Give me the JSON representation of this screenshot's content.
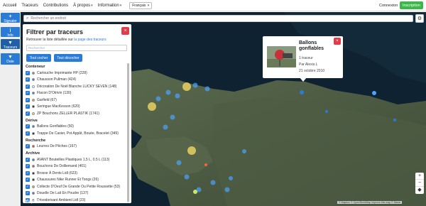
{
  "nav": {
    "items": [
      "Accueil",
      "Traceurs",
      "Contributions",
      "À propos",
      "Information"
    ],
    "language": "Français",
    "login": "Connexion",
    "signup": "Inscription"
  },
  "toolbar": {
    "signal": "Signaler",
    "info": "Info",
    "tracers": "Traceurs",
    "date": "Date"
  },
  "search": {
    "placeholder": "Rechercher un endroit"
  },
  "filter": {
    "title": "Filtrer par traceurs",
    "desc_prefix": "Retrouver la liste détaillée sur",
    "desc_link": "la page des traceurs",
    "filter_placeholder": "Rechercher",
    "check_all": "Tout cocher",
    "uncheck_all": "Tout décocher",
    "groups": [
      {
        "name": "Conteneur",
        "items": [
          {
            "label": "Cartouche Imprimante HP (228)",
            "color": "#888888"
          },
          {
            "label": "Chausson Pullman (424)",
            "color": "#2a7bd6"
          },
          {
            "label": "Décoration De Noël Blanche LUCKY SEVEN (148)",
            "color": "#ffffff"
          },
          {
            "label": "Flacon D'Otrivin (130)",
            "color": "#2a7bd6"
          },
          {
            "label": "Garfield (67)",
            "color": "#f0a030"
          },
          {
            "label": "Seringue MacKesson (620)",
            "color": "#222222"
          },
          {
            "label": "ZP Bouchons ZELLER PLASTIK (1741)",
            "color": "#e8e060"
          }
        ]
      },
      {
        "name": "Dérive",
        "items": [
          {
            "label": "Ballons Gonflables (50)",
            "color": "#2a7bd6"
          },
          {
            "label": "Trappe De Casier, Pot Appât, Bouée, Bracelet (349)",
            "color": "#222222"
          }
        ]
      },
      {
        "name": "Recherche",
        "items": [
          {
            "label": "Leurres De Pêches (167)",
            "color": "#e03c4a"
          }
        ]
      },
      {
        "name": "Archive",
        "items": [
          {
            "label": "AVANT Bouteilles Plastiques 1,5 L, 0,5 L (113)",
            "color": "#2a7bd6"
          },
          {
            "label": "Bouchons De Dolliemand (401)",
            "color": "#e03c4a"
          },
          {
            "label": "Brosse À Dents Lidl (623)",
            "color": "#222222"
          },
          {
            "label": "Chaussures Nike Runner Et Tongs (26)",
            "color": "#222222"
          },
          {
            "label": "Collecte D'Oeuf De Grande Ou Petite Roussette (53)",
            "color": "#f0a030"
          },
          {
            "label": "Douelle De Lait En Poudre (137)",
            "color": "#2a7bd6"
          },
          {
            "label": "Désodorisant Ambient Lidl (23)",
            "color": "#888888"
          }
        ]
      }
    ]
  },
  "popup": {
    "title_line1": "Ballons",
    "title_line2": "gonflables",
    "count": "1 traceur",
    "author": "Par Alexis.L",
    "date": "21 octobre 2010"
  },
  "map": {
    "logo": "mapbox",
    "attribution": "© Mapbox © OpenStreetMap Improve this map © Maxar"
  }
}
